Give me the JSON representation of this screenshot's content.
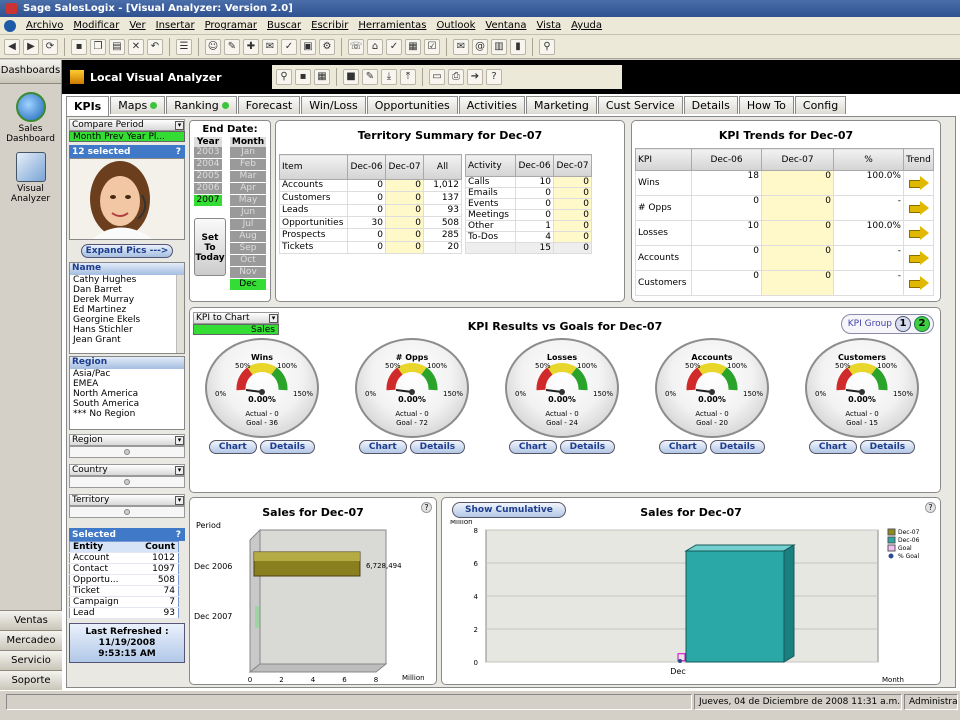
{
  "window": {
    "title": "Sage SalesLogix - [Visual Analyzer: Version 2.0]"
  },
  "menu": [
    "Archivo",
    "Modificar",
    "Ver",
    "Insertar",
    "Programar",
    "Buscar",
    "Escribir",
    "Herramientas",
    "Outlook",
    "Ventana",
    "Vista",
    "Ayuda"
  ],
  "nav": {
    "header": "Dashboards",
    "items": [
      {
        "label": "Sales\nDashboard",
        "icon": "sales-dashboard-icon"
      },
      {
        "label": "Visual\nAnalyzer",
        "icon": "visual-analyzer-icon"
      }
    ],
    "bottom": [
      "Ventas",
      "Mercadeo",
      "Servicio",
      "Soporte"
    ]
  },
  "subheader": {
    "title": "Local Visual Analyzer"
  },
  "tabs": [
    {
      "label": "KPIs",
      "active": true,
      "dot": false
    },
    {
      "label": "Maps",
      "dot": true
    },
    {
      "label": "Ranking",
      "dot": true
    },
    {
      "label": "Forecast"
    },
    {
      "label": "Win/Loss"
    },
    {
      "label": "Opportunities"
    },
    {
      "label": "Activities"
    },
    {
      "label": "Marketing"
    },
    {
      "label": "Cust Service"
    },
    {
      "label": "Details"
    },
    {
      "label": "How To"
    },
    {
      "label": "Config"
    }
  ],
  "filters": {
    "compare_period": {
      "label": "Compare Period",
      "value": "Month Prev Year Pl..."
    },
    "selected_count": "12 selected",
    "expand_label": "Expand Pics --->",
    "name_header": "Name",
    "names": [
      "Cathy Hughes",
      "Dan Barret",
      "Derek Murray",
      "Ed Martinez",
      "Georgine Ekels",
      "Hans Stichler",
      "Jean Grant"
    ],
    "region_header": "Region",
    "regions": [
      "Asia/Pac",
      "EMEA",
      "North America",
      "South America",
      "*** No Region"
    ],
    "sliders": [
      "Region",
      "Country",
      "Territory"
    ],
    "selected_header": "Selected",
    "entity_cols": [
      "Entity",
      "Count"
    ],
    "entities": [
      [
        "Account",
        "1012"
      ],
      [
        "Contact",
        "1097"
      ],
      [
        "Opportu...",
        "508"
      ],
      [
        "Ticket",
        "74"
      ],
      [
        "Campaign",
        "7"
      ],
      [
        "Lead",
        "93"
      ]
    ],
    "refresh": {
      "label": "Last Refreshed :",
      "date": "11/19/2008",
      "time": "9:53:15 AM"
    }
  },
  "enddate": {
    "title": "End Date:",
    "year_label": "Year",
    "month_label": "Month",
    "years": [
      "2003",
      "2004",
      "2005",
      "2006",
      "2007"
    ],
    "selected_year": "2007",
    "months": [
      "Jan",
      "Feb",
      "Mar",
      "Apr",
      "May",
      "Jun",
      "Jul",
      "Aug",
      "Sep",
      "Oct",
      "Nov",
      "Dec"
    ],
    "selected_month": "Dec",
    "set_today": "Set To Today"
  },
  "territory": {
    "title": "Territory Summary for Dec-07",
    "cols": [
      "Item",
      "Dec-06",
      "Dec-07",
      "All"
    ],
    "rows": [
      [
        "Accounts",
        "0",
        "0",
        "1,012"
      ],
      [
        "Customers",
        "0",
        "0",
        "137"
      ],
      [
        "Leads",
        "0",
        "0",
        "93"
      ],
      [
        "Opportunities",
        "30",
        "0",
        "508"
      ],
      [
        "Prospects",
        "0",
        "0",
        "285"
      ],
      [
        "Tickets",
        "0",
        "0",
        "20"
      ]
    ],
    "act_cols": [
      "Activity",
      "Dec-06",
      "Dec-07"
    ],
    "act_rows": [
      [
        "Calls",
        "10",
        "0"
      ],
      [
        "Emails",
        "0",
        "0"
      ],
      [
        "Events",
        "0",
        "0"
      ],
      [
        "Meetings",
        "0",
        "0"
      ],
      [
        "Other",
        "1",
        "0"
      ],
      [
        "To-Dos",
        "4",
        "0"
      ]
    ],
    "act_total": [
      "",
      "15",
      "0"
    ]
  },
  "trends": {
    "title": "KPI Trends for Dec-07",
    "cols": [
      "KPI",
      "Dec-06",
      "Dec-07",
      "%",
      "Trend"
    ],
    "rows": [
      [
        "Wins",
        "18",
        "0",
        "100.0%"
      ],
      [
        "# Opps",
        "0",
        "0",
        "-"
      ],
      [
        "Losses",
        "10",
        "0",
        "100.0%"
      ],
      [
        "Accounts",
        "0",
        "0",
        "-"
      ],
      [
        "Customers",
        "0",
        "0",
        "-"
      ]
    ]
  },
  "kpi": {
    "title": "KPI Results vs Goals for Dec-07",
    "kpi_to_chart_label": "KPI to Chart",
    "kpi_to_chart_value": "Sales",
    "group_label": "KPI Group",
    "groups": [
      "1",
      "2"
    ],
    "gauges": [
      {
        "name": "Wins",
        "value": "0.00%",
        "actual": "Actual - 0",
        "goal": "Goal - 36"
      },
      {
        "name": "# Opps",
        "value": "0.00%",
        "actual": "Actual - 0",
        "goal": "Goal - 72"
      },
      {
        "name": "Losses",
        "value": "0.00%",
        "actual": "Actual - 0",
        "goal": "Goal - 24"
      },
      {
        "name": "Accounts",
        "value": "0.00%",
        "actual": "Actual - 0",
        "goal": "Goal - 20"
      },
      {
        "name": "Customers",
        "value": "0.00%",
        "actual": "Actual - 0",
        "goal": "Goal - 15"
      }
    ],
    "ticks": [
      "0%",
      "50%",
      "100%",
      "150%"
    ],
    "chart_btn": "Chart",
    "details_btn": "Details"
  },
  "sales_left": {
    "title": "Sales for Dec-07",
    "ylabel": "Period",
    "xlabel": "Million",
    "categories": [
      "Dec 2006",
      "Dec 2007"
    ],
    "value_label": "6,728,494",
    "ticks": [
      "0",
      "2",
      "4",
      "6",
      "8"
    ]
  },
  "sales_right": {
    "title": "Sales for Dec-07",
    "show_cumulative": "Show Cumulative",
    "ylabel": "Million",
    "xlabel": "Month",
    "xcat": "Dec",
    "ticks": [
      "0",
      "2",
      "4",
      "6",
      "8"
    ],
    "legend": [
      "Dec-07",
      "Dec-06",
      "Goal",
      "% Goal"
    ]
  },
  "chart_data": [
    {
      "type": "bar",
      "title": "Sales for Dec-07",
      "categories": [
        "Dec 2006",
        "Dec 2007"
      ],
      "values": [
        6728494,
        0
      ],
      "xlabel": "Million",
      "ylabel": "Period",
      "xlim": [
        0,
        8
      ]
    },
    {
      "type": "bar",
      "title": "Sales for Dec-07",
      "categories": [
        "Dec"
      ],
      "series": [
        {
          "name": "Dec-07",
          "values": [
            0
          ]
        },
        {
          "name": "Dec-06",
          "values": [
            6.73
          ]
        },
        {
          "name": "Goal",
          "values": [
            0
          ]
        }
      ],
      "xlabel": "Month",
      "ylabel": "Million",
      "ylim": [
        0,
        8
      ]
    }
  ],
  "status": {
    "date": "Jueves, 04 de Diciembre de 2008 11:31 a.m.",
    "user": "Administrator"
  }
}
